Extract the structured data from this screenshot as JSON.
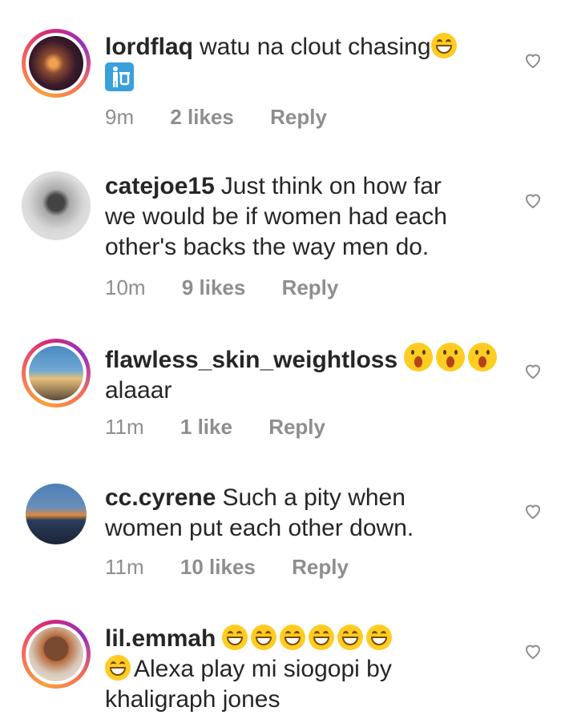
{
  "comments": [
    {
      "username": "lordflaq",
      "text": "watu na clout chasing",
      "emojis_inline": [
        "face-with-tears-of-joy"
      ],
      "extra_emoji": "water-closet-symbol",
      "time": "9m",
      "likes": "2 likes",
      "reply": "Reply",
      "has_story_ring": true
    },
    {
      "username": "catejoe15",
      "text": "Just think on how far",
      "text_line2": "we would be if women had each",
      "text_line3": "other's backs the way men do.",
      "time": "10m",
      "likes": "9 likes",
      "reply": "Reply",
      "has_story_ring": false
    },
    {
      "username": "flawless_skin_weightloss",
      "emojis_inline": [
        "face-with-open-mouth",
        "face-with-open-mouth",
        "face-with-open-mouth"
      ],
      "text_line2": "alaaar",
      "time": "11m",
      "likes": "1 like",
      "reply": "Reply",
      "has_story_ring": true
    },
    {
      "username": "cc.cyrene",
      "text": "Such a pity when",
      "text_line2": "women put each other down.",
      "time": "11m",
      "likes": "10 likes",
      "reply": "Reply",
      "has_story_ring": false
    },
    {
      "username": "lil.emmah",
      "emojis_inline": [
        "face-with-tears-of-joy",
        "face-with-tears-of-joy",
        "face-with-tears-of-joy",
        "face-with-tears-of-joy",
        "face-with-tears-of-joy",
        "face-with-tears-of-joy"
      ],
      "text_line2": "Alexa play mi siogopi by",
      "text_line3": "khaligraph jones",
      "has_story_ring": true
    }
  ],
  "icons": {
    "like": "heart-outline-icon"
  },
  "colors": {
    "text": "#262626",
    "meta": "#8e8e8e",
    "ring_start": "#f9a13a",
    "ring_end": "#d62976"
  }
}
